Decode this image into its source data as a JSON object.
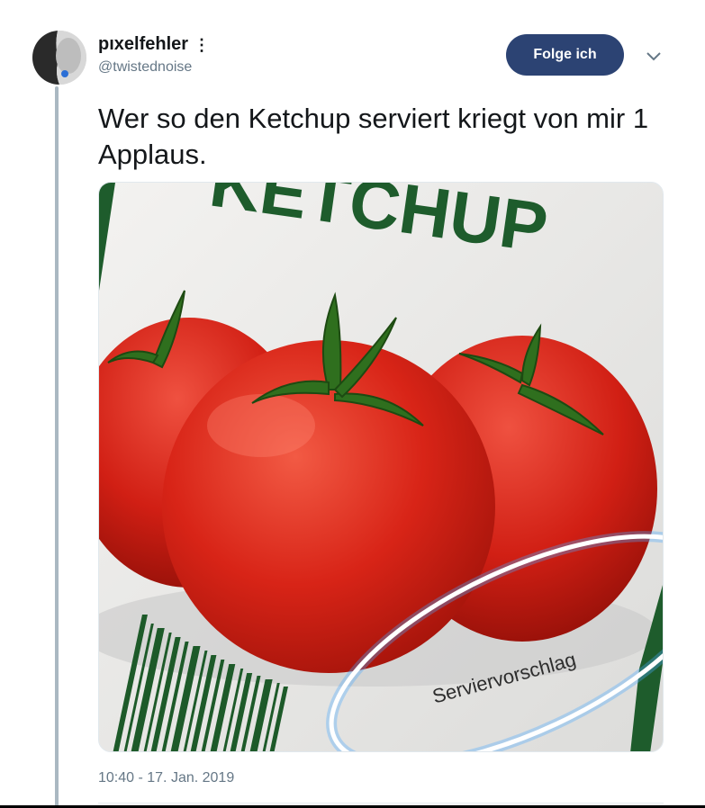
{
  "author": {
    "display_name": "pıxelfehler",
    "handle": "@twistednoise"
  },
  "header": {
    "follow_label": "Folge ich",
    "more_icon": "kebab-icon",
    "menu_icon": "chevron-down-icon"
  },
  "tweet": {
    "text": "Wer so den Ketchup serviert kriegt von mir 1 Applaus.",
    "timestamp": "10:40 - 17. Jan. 2019"
  },
  "media": {
    "label_heading": "KETCHUP",
    "label_note": "Serviervorschlag"
  },
  "colors": {
    "follow_button": "#2c4373",
    "thread_line": "#aab8c2",
    "secondary_text": "#657786"
  }
}
